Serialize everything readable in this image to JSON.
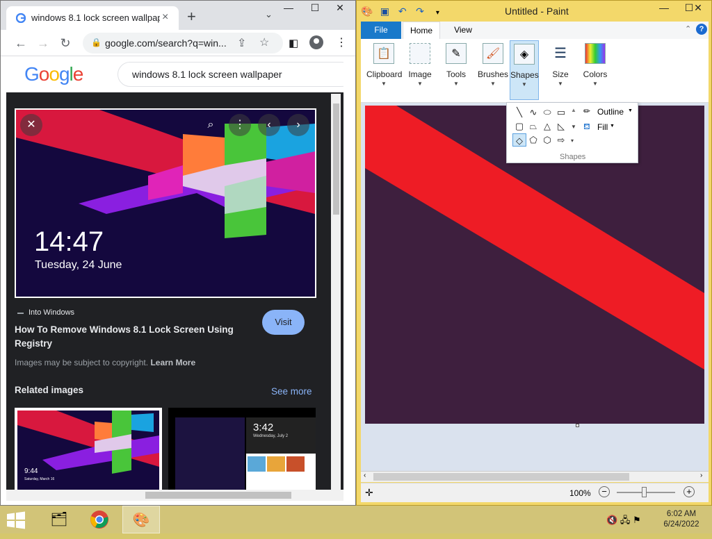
{
  "chrome": {
    "tab_title": "windows 8.1 lock screen wallpap",
    "url": "google.com/search?q=win...",
    "search_query": "windows 8.1 lock screen wallpaper",
    "preview": {
      "time": "14:47",
      "date": "Tuesday, 24 June"
    },
    "result": {
      "source": "Into Windows",
      "title": "How To Remove Windows 8.1 Lock Screen Using Registry",
      "visit_label": "Visit",
      "copyright_text": "Images may be subject to copyright.",
      "learn_more": "Learn More"
    },
    "related_label": "Related images",
    "see_more_label": "See more",
    "thumb1": {
      "time": "9:44",
      "date": "Saturday, March 16"
    },
    "thumb2": {
      "time": "3:42",
      "date": "Wednesday, July 2"
    },
    "google_logo": "Google"
  },
  "paint": {
    "window_title": "Untitled - Paint",
    "tabs": [
      "File",
      "Home",
      "View"
    ],
    "groups": [
      "Clipboard",
      "Image",
      "Tools",
      "Brushes",
      "Shapes",
      "Size",
      "Colors"
    ],
    "shapes_menu": {
      "outline": "Outline",
      "fill": "Fill",
      "caption": "Shapes"
    },
    "zoom": "100%"
  },
  "taskbar": {
    "time": "6:02 AM",
    "date": "6/24/2022"
  },
  "colors": {
    "accent": "#1979ca",
    "chrome_link": "#8ab4f8",
    "canvas_bg": "#3e1f3e",
    "stripe": "#ee1c25"
  }
}
